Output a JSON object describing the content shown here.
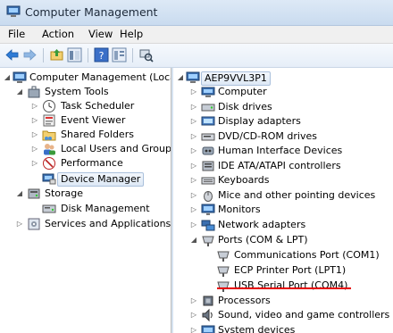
{
  "window": {
    "title": "Computer Management"
  },
  "menu": [
    "File",
    "Action",
    "View",
    "Help"
  ],
  "toolbar": {
    "icons": [
      "back-arrow-icon",
      "forward-arrow-icon",
      "up-folder-icon",
      "show-hide-tree-icon",
      "help-icon",
      "properties-icon",
      "scan-hardware-icon"
    ]
  },
  "left_tree": [
    {
      "label": "Computer Management (Local",
      "icon": "computer-management-icon",
      "arrow": "down"
    },
    {
      "label": "System Tools",
      "icon": "toolbox-icon",
      "arrow": "down"
    },
    {
      "label": "Task Scheduler",
      "icon": "clock-icon",
      "arrow": "right"
    },
    {
      "label": "Event Viewer",
      "icon": "event-viewer-icon",
      "arrow": "right"
    },
    {
      "label": "Shared Folders",
      "icon": "shared-folder-icon",
      "arrow": "right"
    },
    {
      "label": "Local Users and Groups",
      "icon": "users-icon",
      "arrow": "right"
    },
    {
      "label": "Performance",
      "icon": "performance-icon",
      "arrow": "right"
    },
    {
      "label": "Device Manager",
      "icon": "device-manager-icon",
      "arrow": "none",
      "selected": true
    },
    {
      "label": "Storage",
      "icon": "storage-icon",
      "arrow": "down"
    },
    {
      "label": "Disk Management",
      "icon": "disk-icon",
      "arrow": "none"
    },
    {
      "label": "Services and Applications",
      "icon": "services-icon",
      "arrow": "right"
    }
  ],
  "right_tree": [
    {
      "label": "AEP9VVL3P1",
      "icon": "computer-icon",
      "arrow": "down"
    },
    {
      "label": "Computer",
      "icon": "computer-icon",
      "arrow": "right"
    },
    {
      "label": "Disk drives",
      "icon": "disk-drive-icon",
      "arrow": "right"
    },
    {
      "label": "Display adapters",
      "icon": "display-adapter-icon",
      "arrow": "right"
    },
    {
      "label": "DVD/CD-ROM drives",
      "icon": "dvd-drive-icon",
      "arrow": "right"
    },
    {
      "label": "Human Interface Devices",
      "icon": "hid-icon",
      "arrow": "right"
    },
    {
      "label": "IDE ATA/ATAPI controllers",
      "icon": "ide-controller-icon",
      "arrow": "right"
    },
    {
      "label": "Keyboards",
      "icon": "keyboard-icon",
      "arrow": "right"
    },
    {
      "label": "Mice and other pointing devices",
      "icon": "mouse-icon",
      "arrow": "right"
    },
    {
      "label": "Monitors",
      "icon": "monitor-icon",
      "arrow": "right"
    },
    {
      "label": "Network adapters",
      "icon": "network-adapter-icon",
      "arrow": "right"
    },
    {
      "label": "Ports (COM & LPT)",
      "icon": "port-icon",
      "arrow": "down"
    },
    {
      "label": "Communications Port (COM1)",
      "icon": "port-icon",
      "arrow": "none"
    },
    {
      "label": "ECP Printer Port (LPT1)",
      "icon": "port-icon",
      "arrow": "none"
    },
    {
      "label": "USB Serial Port (COM4)",
      "icon": "port-icon",
      "arrow": "none",
      "highlighted": true
    },
    {
      "label": "Processors",
      "icon": "processor-icon",
      "arrow": "right"
    },
    {
      "label": "Sound, video and game controllers",
      "icon": "sound-icon",
      "arrow": "right"
    },
    {
      "label": "System devices",
      "icon": "system-devices-icon",
      "arrow": "right"
    }
  ],
  "colors": {
    "highlight_underline": "#e60000",
    "selection_border": "#aac0dc"
  }
}
